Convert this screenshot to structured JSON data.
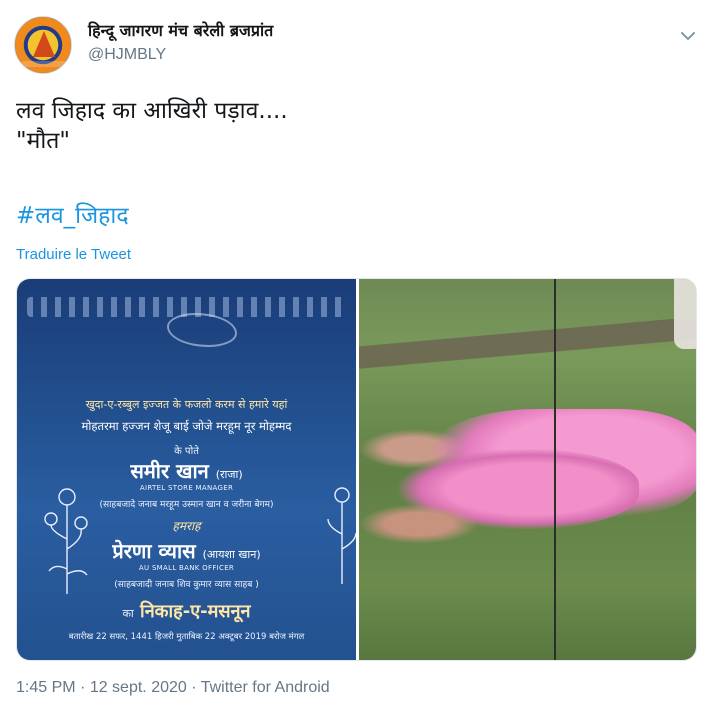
{
  "author": {
    "display_name": "हिन्दू जागरण मंच बरेली ब्रजप्रांत",
    "handle": "@HJMBLY"
  },
  "tweet": {
    "text": "लव जिहाद का आखिरी पड़ाव....\n\"मौत\"",
    "hashtag": "#लव_जिहाद",
    "translate_label": "Traduire le Tweet"
  },
  "media": {
    "card": {
      "line1": "खुदा-ए-रब्बुल इज्जत के फजलो करम से हमारे यहां",
      "line2": "मोहतरमा हज्जन शेजू बाई जोजे मरहूम नूर मोहम्मद",
      "line3": "के पोते",
      "groom": "समीर खान",
      "groom_nick": "(राजा)",
      "groom_job": "AIRTEL STORE MANAGER",
      "groom_parents": "(साहबजादे जनाब मरहूम उस्मान खान व जरीना बेगम)",
      "connector": "हमराह",
      "bride": "प्रेरणा व्यास",
      "bride_nick": "(आयशा खान)",
      "bride_job": "AU SMALL BANK OFFICER",
      "bride_parents": "(साहबजादी जनाब शिव कुमार व्यास साहब )",
      "nikah_prefix": "का",
      "nikah": "निकाह-ए-मसनून",
      "date_line": "बतारीख 22 सफर, 1441 हिजरी मुताबिक 22 अक्टूबर 2019 बरोज मंगल"
    }
  },
  "footer": {
    "time": "1:45 PM",
    "sep1": " · ",
    "date": "12 sept. 2020",
    "sep2": " · ",
    "source": "Twitter for Android"
  },
  "colors": {
    "link": "#1b95e0",
    "secondary_text": "#657786",
    "primary_text": "#14171a"
  },
  "icons": {
    "more": "chevron-down-icon",
    "avatar": "avatar"
  }
}
